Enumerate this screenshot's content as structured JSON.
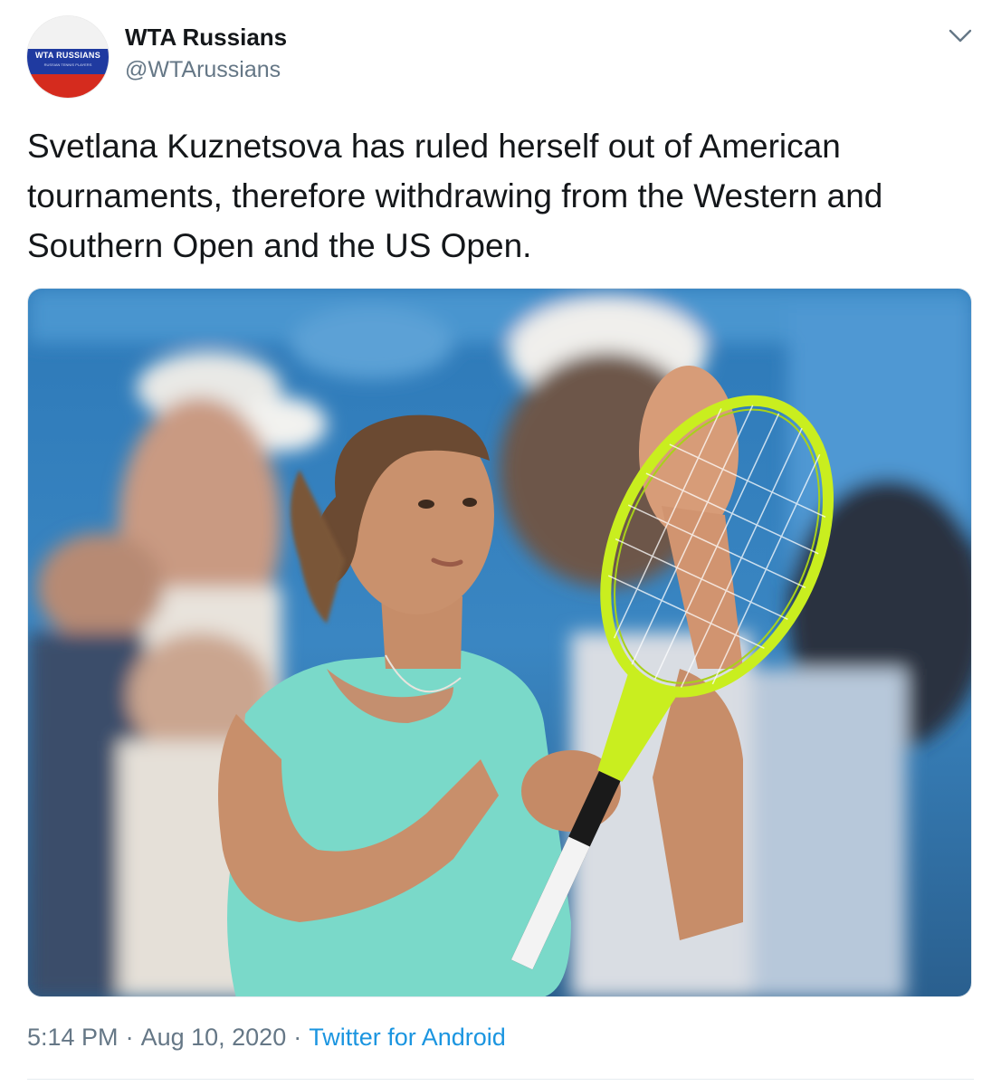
{
  "author": {
    "display_name": "WTA Russians",
    "handle": "@WTArussians",
    "avatar_logo_text": "WTA RUSSIANS",
    "avatar_logo_subtext": "RUSSIAN TENNIS PLAYERS"
  },
  "tweet": {
    "text": "Svetlana Kuznetsova has ruled herself out of American tournaments, therefore withdrawing from the Western and Southern Open and the US Open.",
    "media_icon": "photo-tennis-player"
  },
  "meta": {
    "time": "5:14 PM",
    "date": "Aug 10, 2020",
    "source": "Twitter for Android",
    "separator": "·"
  },
  "icons": {
    "menu": "chevron-down-icon"
  },
  "colors": {
    "text_primary": "#14171a",
    "text_secondary": "#657786",
    "link": "#1b95e0",
    "border": "#e1e8ed"
  }
}
